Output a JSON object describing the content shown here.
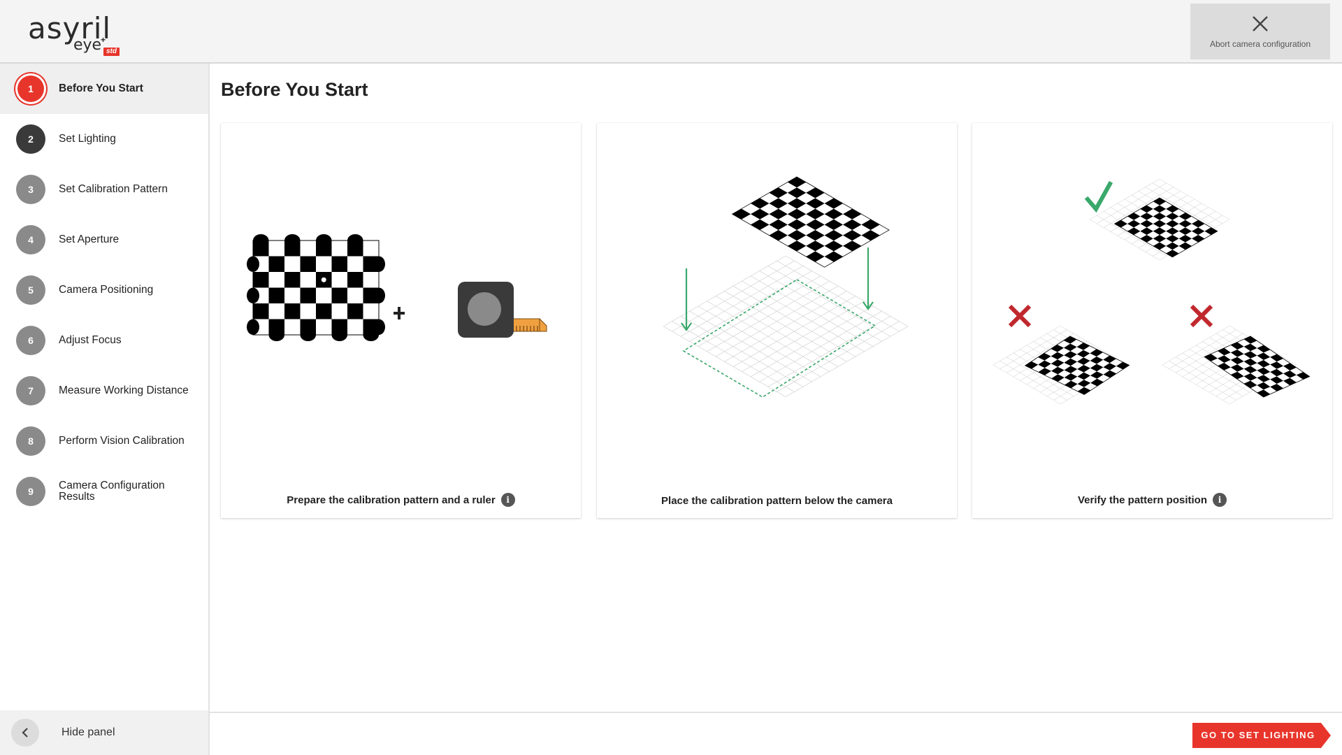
{
  "brand": {
    "word": "asyril",
    "sub": "eye",
    "sup": "+",
    "badge": "std"
  },
  "header": {
    "abort_label": "Abort camera configuration"
  },
  "sidebar": {
    "steps": [
      {
        "num": "1",
        "label": "Before You Start"
      },
      {
        "num": "2",
        "label": "Set Lighting"
      },
      {
        "num": "3",
        "label": "Set Calibration Pattern"
      },
      {
        "num": "4",
        "label": "Set Aperture"
      },
      {
        "num": "5",
        "label": "Camera Positioning"
      },
      {
        "num": "6",
        "label": "Adjust Focus"
      },
      {
        "num": "7",
        "label": "Measure Working Distance"
      },
      {
        "num": "8",
        "label": "Perform Vision Calibration"
      },
      {
        "num": "9",
        "label": "Camera Configuration Results"
      }
    ],
    "hide_label": "Hide panel"
  },
  "main": {
    "title": "Before You Start",
    "cards": [
      {
        "caption": "Prepare the calibration pattern and a ruler",
        "has_info": true
      },
      {
        "caption": "Place the calibration pattern below the camera",
        "has_info": false
      },
      {
        "caption": "Verify the pattern position",
        "has_info": true
      }
    ],
    "info_glyph": "i"
  },
  "footer": {
    "next_label": "GO TO SET LIGHTING"
  },
  "colors": {
    "accent": "#e8352b",
    "valid": "#3aa86b",
    "invalid": "#c0282d",
    "tape": "#f0a040"
  }
}
